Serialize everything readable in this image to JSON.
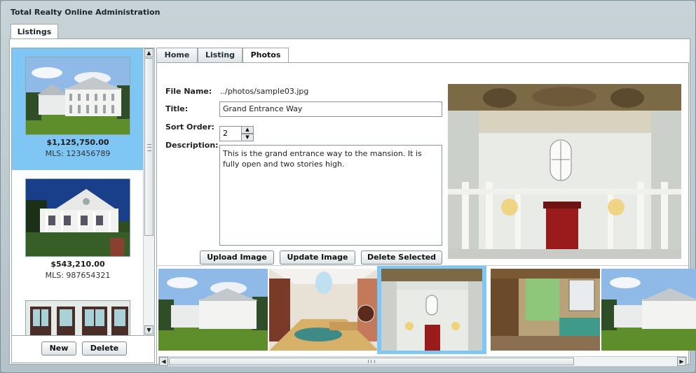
{
  "app": {
    "title": "Total Realty Online Administration"
  },
  "outer_tabs": [
    {
      "label": "Listings"
    }
  ],
  "listings": [
    {
      "price": "$1,125,750.00",
      "mls": "MLS: 123456789",
      "image": "white-mansion-photo"
    },
    {
      "price": "$543,210.00",
      "mls": "MLS: 987654321",
      "image": "blue-victorian-house-photo"
    },
    {
      "price": "",
      "mls": "",
      "image": "interior-windows-photo"
    }
  ],
  "list_buttons": {
    "new_label": "New",
    "delete_label": "Delete"
  },
  "detail_tabs": [
    {
      "label": "Home"
    },
    {
      "label": "Listing"
    },
    {
      "label": "Photos"
    }
  ],
  "photo_form": {
    "file_name_label": "File Name:",
    "file_name_value": "../photos/sample03.jpg",
    "title_label": "Title:",
    "title_value": "Grand Entrance Way",
    "sort_order_label": "Sort Order:",
    "sort_order_value": "2",
    "description_label": "Description:",
    "description_value": "This is the grand entrance way to the mansion. It is fully open and two stories high."
  },
  "photo_buttons": {
    "upload_label": "Upload Image",
    "update_label": "Update Image",
    "delete_selected_label": "Delete Selected"
  },
  "thumbnails": [
    {
      "image": "white-mansion-photo"
    },
    {
      "image": "modern-living-room-photo"
    },
    {
      "image": "grand-hall-photo",
      "selected": true
    },
    {
      "image": "japanese-interior-photo"
    },
    {
      "image": "white-mansion-photo"
    }
  ],
  "colors": {
    "selection": "#7fc6f5",
    "panel_border": "#9aa8ae",
    "window_bg": "#b3c1c8"
  }
}
